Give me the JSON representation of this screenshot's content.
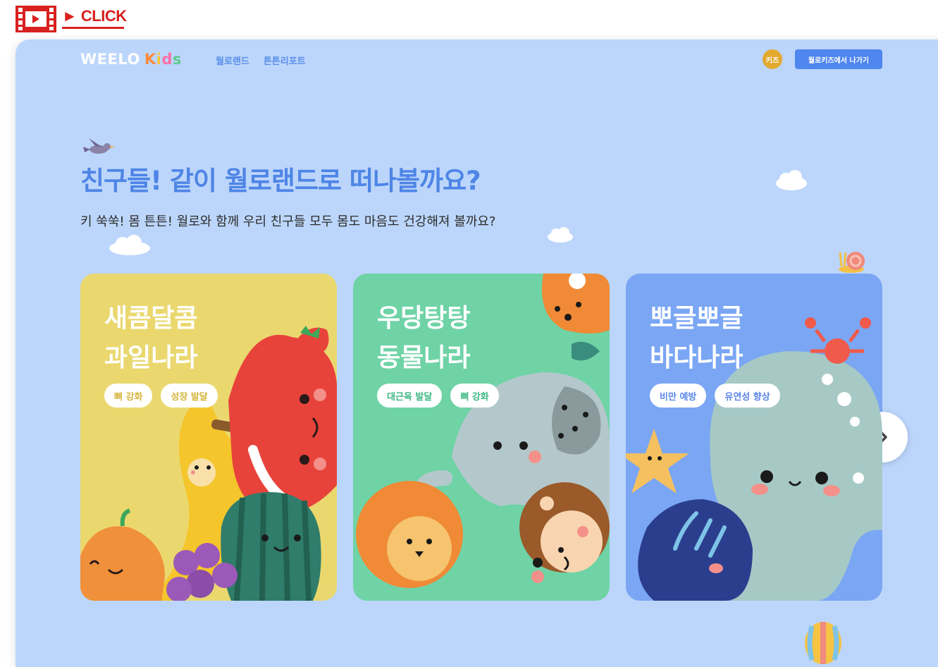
{
  "video_bar": {
    "click_label": "► CLICK"
  },
  "nav": {
    "logo_main": "WEELO",
    "logo_kids": "Kids",
    "links": [
      "월로랜드",
      "튼튼리포트"
    ],
    "avatar_label": "키즈",
    "exit_label": "월로키즈에서 나가기"
  },
  "hero": {
    "title": "친구들! 같이 월로랜드로 떠나볼까요?",
    "subtitle": "키 쑥쑥! 몸 튼튼! 월로와 함께 우리 친구들 모두 몸도 마음도 건강해져 볼까요?"
  },
  "cards": [
    {
      "title_line1": "새콤달콤",
      "title_line2": "과일나라",
      "tags": [
        "뼈 강화",
        "성장 발달"
      ],
      "bg": "#ead86f",
      "tag_color": "#d4b53b"
    },
    {
      "title_line1": "우당탕탕",
      "title_line2": "동물나라",
      "tags": [
        "대근육 발달",
        "뼈 강화"
      ],
      "bg": "#6fd3a6",
      "tag_color": "#3fb784"
    },
    {
      "title_line1": "뽀글뽀글",
      "title_line2": "바다나라",
      "tags": [
        "비만 예방",
        "유연성 향상"
      ],
      "bg": "#7aa6f4",
      "tag_color": "#5a86e6"
    }
  ],
  "colors": {
    "page_bg": "#bcd6fb",
    "accent": "#4e85e6",
    "exit_button": "#4f86ef",
    "click_red": "#d8201f"
  },
  "icons": {
    "next": "chevron-right-icon",
    "video": "film-strip-icon"
  }
}
